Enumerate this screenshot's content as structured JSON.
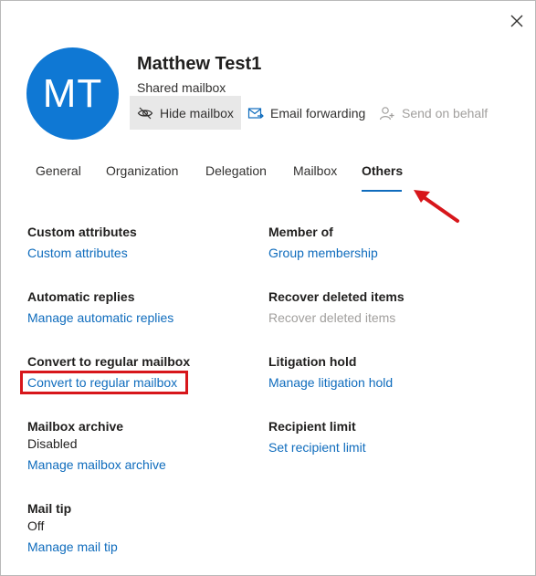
{
  "close": {
    "label": "Close"
  },
  "profile": {
    "initials": "MT",
    "name": "Matthew Test1",
    "type": "Shared mailbox",
    "avatar_color": "#0f78d4"
  },
  "actions": {
    "hide_mailbox": "Hide mailbox",
    "email_forwarding": "Email forwarding",
    "send_on_behalf": "Send on behalf"
  },
  "tabs": [
    {
      "label": "General",
      "active": false
    },
    {
      "label": "Organization",
      "active": false
    },
    {
      "label": "Delegation",
      "active": false
    },
    {
      "label": "Mailbox",
      "active": false
    },
    {
      "label": "Others",
      "active": true
    }
  ],
  "sections": {
    "custom_attributes": {
      "title": "Custom attributes",
      "link": "Custom attributes"
    },
    "member_of": {
      "title": "Member of",
      "link": "Group membership"
    },
    "automatic_replies": {
      "title": "Automatic replies",
      "link": "Manage automatic replies"
    },
    "recover_deleted": {
      "title": "Recover deleted items",
      "link": "Recover deleted items",
      "link_disabled": true
    },
    "convert_regular": {
      "title": "Convert to regular mailbox",
      "link": "Convert to regular mailbox"
    },
    "litigation_hold": {
      "title": "Litigation hold",
      "link": "Manage litigation hold"
    },
    "mailbox_archive": {
      "title": "Mailbox archive",
      "value": "Disabled",
      "link": "Manage mailbox archive"
    },
    "recipient_limit": {
      "title": "Recipient limit",
      "link": "Set recipient limit"
    },
    "mail_tip": {
      "title": "Mail tip",
      "value": "Off",
      "link": "Manage mail tip"
    }
  },
  "colors": {
    "accent": "#0f6cbd",
    "annotation": "#d7161b",
    "disabled": "#a19f9d"
  }
}
